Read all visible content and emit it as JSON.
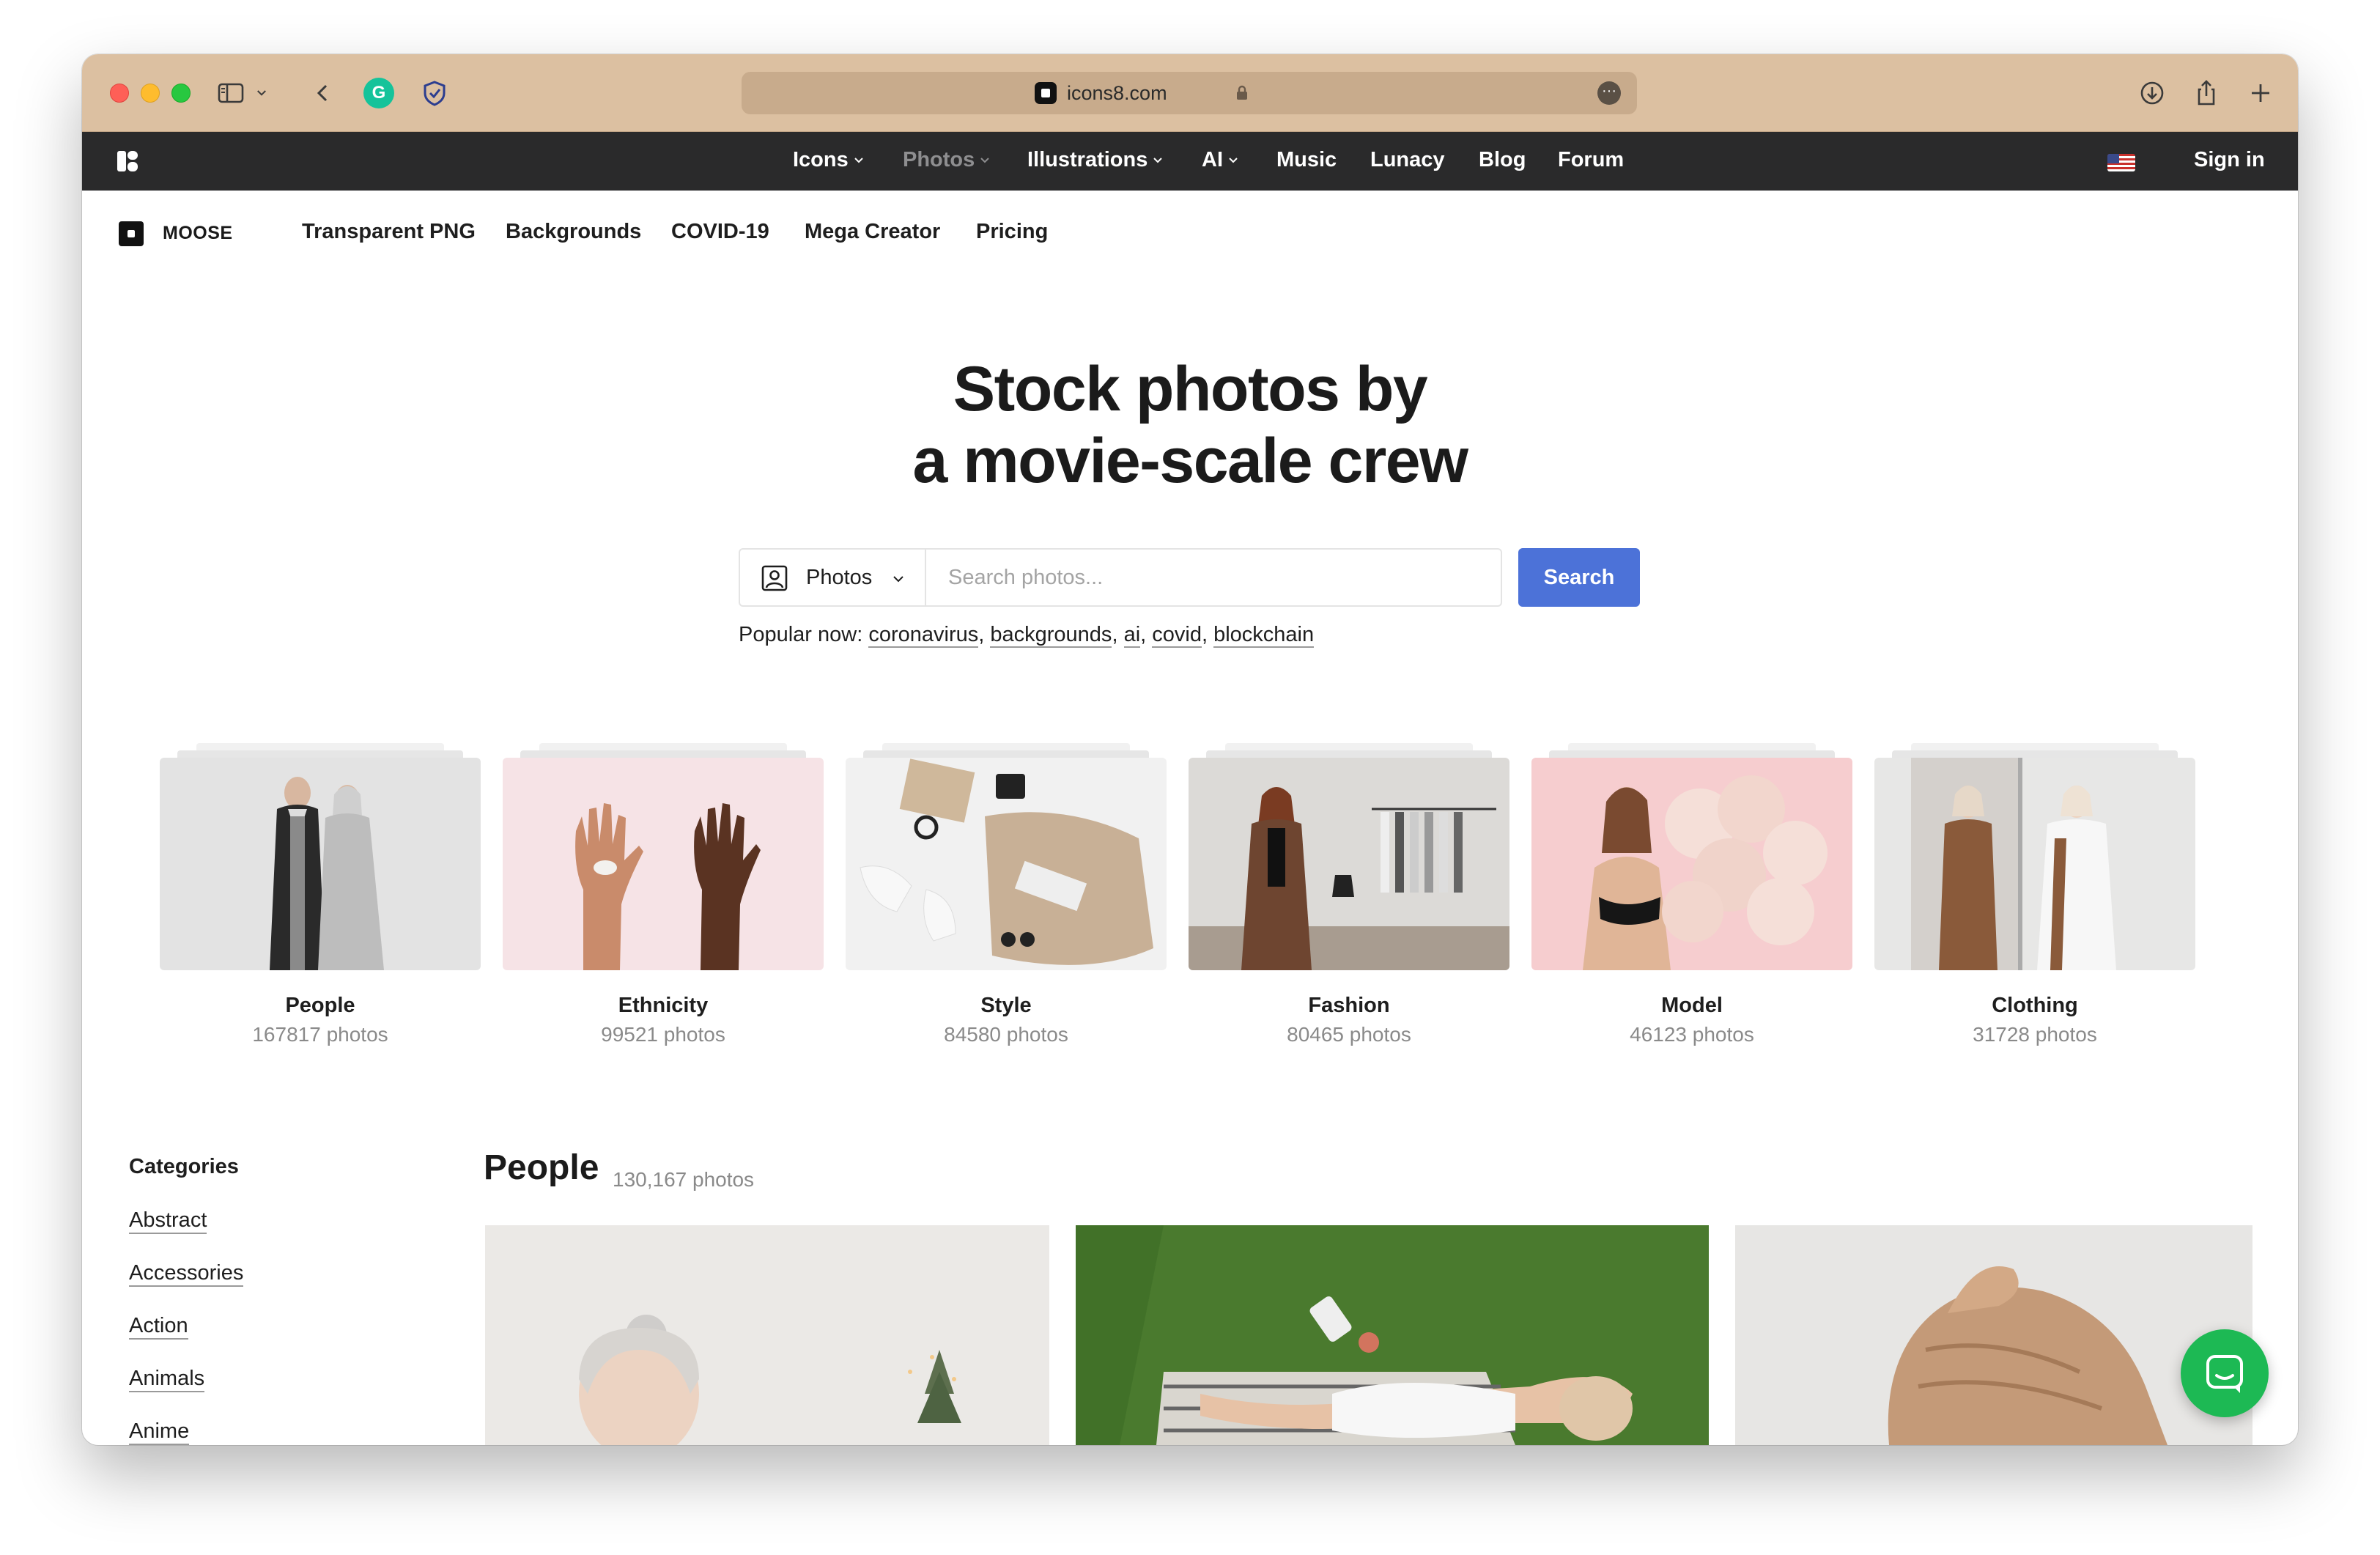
{
  "browser": {
    "url": "icons8.com"
  },
  "topnav": {
    "items": [
      {
        "label": "Icons"
      },
      {
        "label": "Photos"
      },
      {
        "label": "Illustrations"
      },
      {
        "label": "AI"
      },
      {
        "label": "Music"
      },
      {
        "label": "Lunacy"
      },
      {
        "label": "Blog"
      },
      {
        "label": "Forum"
      }
    ],
    "active_item": "Photos",
    "signin": "Sign in"
  },
  "subnav": {
    "brand": "MOOSE",
    "items": [
      "Transparent PNG",
      "Backgrounds",
      "COVID-19",
      "Mega Creator",
      "Pricing"
    ]
  },
  "hero": {
    "title_line1": "Stock photos by",
    "title_line2": "a movie-scale crew"
  },
  "search": {
    "type_label": "Photos",
    "placeholder": "Search photos...",
    "value": "",
    "button": "Search",
    "accent_color": "#4c72d8"
  },
  "popular": {
    "label": "Popular now:",
    "tags": [
      "coronavirus",
      "backgrounds",
      "ai",
      "covid",
      "blockchain"
    ]
  },
  "collections": [
    {
      "title": "People",
      "count": "167817 photos"
    },
    {
      "title": "Ethnicity",
      "count": "99521 photos"
    },
    {
      "title": "Style",
      "count": "84580 photos"
    },
    {
      "title": "Fashion",
      "count": "80465 photos"
    },
    {
      "title": "Model",
      "count": "46123 photos"
    },
    {
      "title": "Clothing",
      "count": "31728 photos"
    }
  ],
  "categories": {
    "title": "Categories",
    "items": [
      "Abstract",
      "Accessories",
      "Action",
      "Animals",
      "Anime"
    ]
  },
  "section": {
    "title": "People",
    "count": "130,167 photos"
  },
  "chat": {
    "icon": "chat-icon",
    "color": "#1db954"
  }
}
